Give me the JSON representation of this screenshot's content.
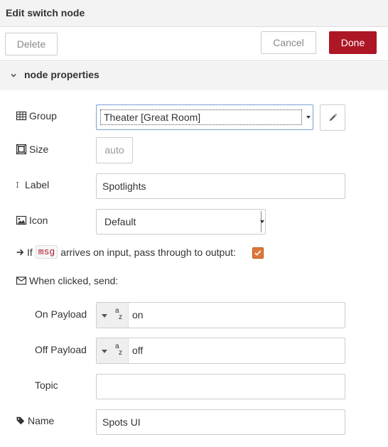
{
  "dialog": {
    "title": "Edit switch node"
  },
  "toolbar": {
    "delete_label": "Delete",
    "cancel_label": "Cancel",
    "done_label": "Done",
    "done_color": "#ad1625"
  },
  "section": {
    "title": "node properties"
  },
  "fields": {
    "group": {
      "label": "Group",
      "value": "Theater [Great Room]"
    },
    "size": {
      "label": "Size",
      "value": "auto"
    },
    "label": {
      "label": "Label",
      "value": "Spotlights"
    },
    "icon": {
      "label": "Icon",
      "value": "Default"
    },
    "passthrough": {
      "prefix": "If",
      "code": "msg",
      "suffix": "arrives on input, pass through to output:",
      "checked": true
    },
    "when_clicked": {
      "label": "When clicked, send:"
    },
    "on_payload": {
      "label": "On Payload",
      "type": "string",
      "value": "on"
    },
    "off_payload": {
      "label": "Off Payload",
      "type": "string",
      "value": "off"
    },
    "topic": {
      "label": "Topic",
      "value": ""
    },
    "name": {
      "label": "Name",
      "value": "Spots UI"
    }
  },
  "accent": "#e07838"
}
